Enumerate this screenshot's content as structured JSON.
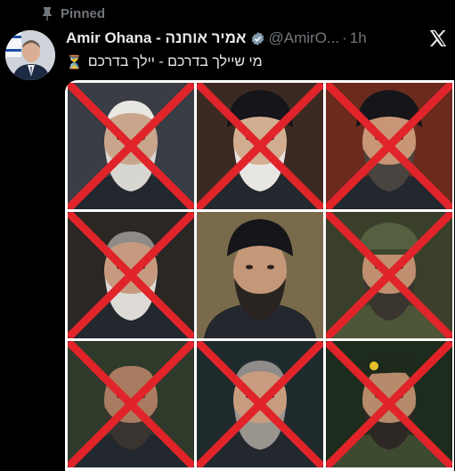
{
  "pinned": {
    "label": "Pinned",
    "icon": "pin-icon"
  },
  "post": {
    "display_name": "Amir Ohana - אמיר אוחנה",
    "verified_icon": "verified-badge-icon",
    "handle": "@AmirO...",
    "separator": "·",
    "time": "1h",
    "text": "מי שיילך בדרכם - יילך בדרכם",
    "text_icon": "hourglass-icon",
    "platform_icon": "x-logo-icon"
  },
  "image_grid": {
    "rows": 3,
    "columns": 3,
    "cells": [
      {
        "crossed": true,
        "bg": "#3a3d44",
        "face": "#c9a58c",
        "head": "white-hair",
        "beard": "#d8d6d0"
      },
      {
        "crossed": true,
        "bg": "#3b2a22",
        "face": "#d3ad90",
        "head": "black-turban",
        "beard": "#e8e6e2"
      },
      {
        "crossed": true,
        "bg": "#6b2a1d",
        "face": "#c89676",
        "head": "black-turban",
        "beard": "#4a4440"
      },
      {
        "crossed": true,
        "bg": "#2a2724",
        "face": "#c79a80",
        "head": "grey-hair",
        "beard": "#dedbd6"
      },
      {
        "crossed": false,
        "bg": "#7a6a4c",
        "face": "#c49779",
        "head": "black-turban",
        "beard": "#2a2420"
      },
      {
        "crossed": true,
        "bg": "#3a3f2a",
        "face": "#bf8f6f",
        "head": "camo-cap",
        "beard": "#3a342f"
      },
      {
        "crossed": true,
        "bg": "#2f3a2b",
        "face": "#a97c61",
        "head": "bald",
        "beard": "#3a3430"
      },
      {
        "crossed": true,
        "bg": "#1f2a2c",
        "face": "#c99c80",
        "head": "grey-hair",
        "beard": "#9b9590"
      },
      {
        "crossed": true,
        "bg": "#1e2c1d",
        "face": "#b68a6b",
        "head": "beret",
        "beard": "#2e2824"
      }
    ],
    "cross_color": "#e0242a"
  }
}
